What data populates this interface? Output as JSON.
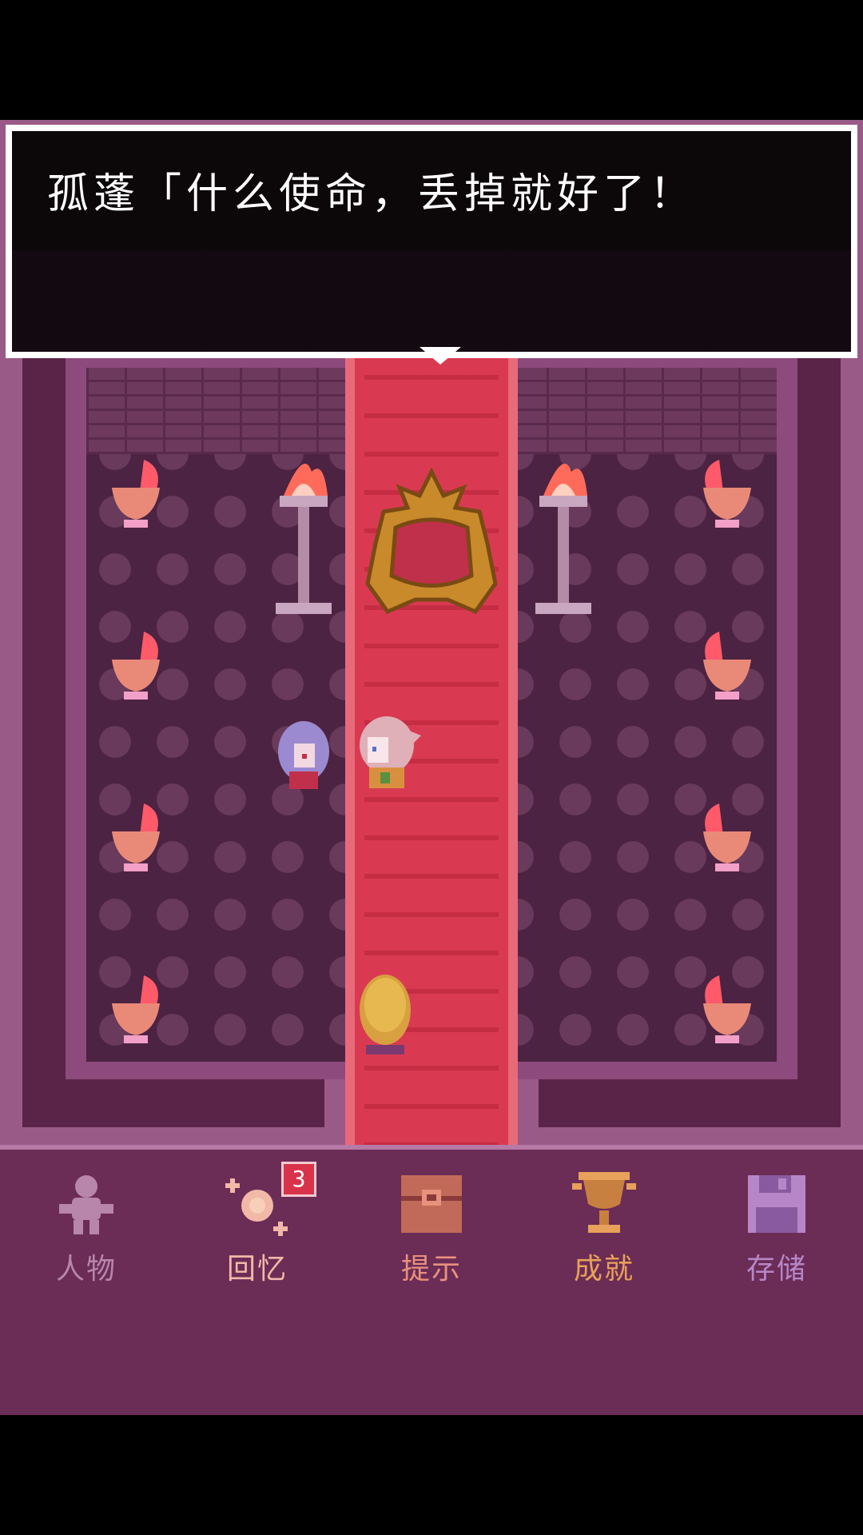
{
  "dialog": {
    "text": "孤蓬「什么使命，丢掉就好了！"
  },
  "menu": {
    "items": [
      {
        "label": "人物",
        "icon": "person-icon",
        "color": "#b786aa"
      },
      {
        "label": "回忆",
        "icon": "memory-sparkle-icon",
        "color": "#f2b8a8"
      },
      {
        "label": "提示",
        "icon": "treasure-chest-icon",
        "color": "#e8917d"
      },
      {
        "label": "成就",
        "icon": "trophy-icon",
        "color": "#e8a15a"
      },
      {
        "label": "存储",
        "icon": "floppy-disk-icon",
        "color": "#b786c8"
      }
    ],
    "badge_count": "3"
  },
  "colors": {
    "carpet": "#d93a52",
    "menu_bg": "#6b2c56",
    "dialog_bg": "#0c0709",
    "badge": "#d8334a"
  }
}
